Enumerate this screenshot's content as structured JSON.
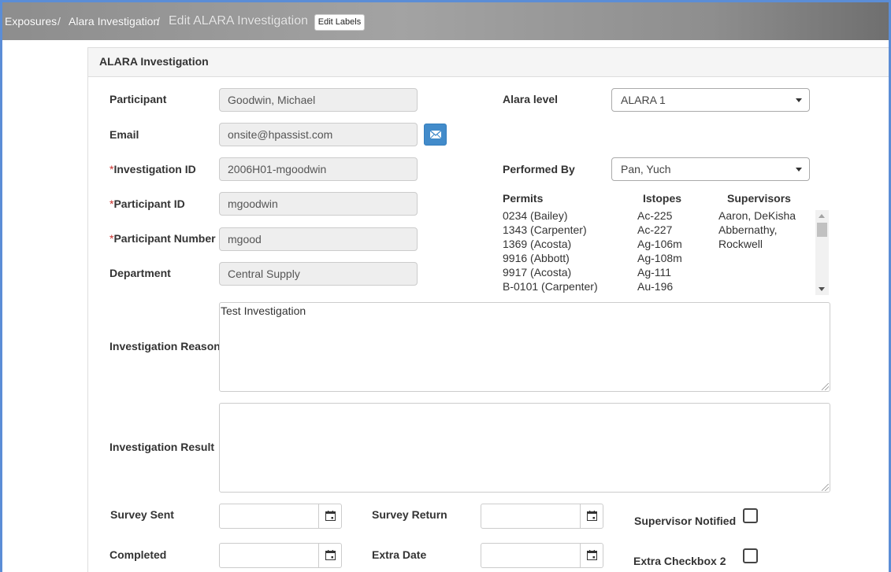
{
  "breadcrumb": {
    "items": [
      "Exposures",
      "Alara Investigation"
    ],
    "separator": "/",
    "current": "Edit ALARA Investigation",
    "edit_labels_button": "Edit Labels"
  },
  "panel": {
    "title": "ALARA Investigation"
  },
  "form": {
    "required_marker": "*",
    "participant": {
      "label": "Participant",
      "value": "Goodwin, Michael"
    },
    "email": {
      "label": "Email",
      "value": "onsite@hpassist.com",
      "button_icon": "envelope-icon"
    },
    "investigation_id": {
      "label": "Investigation ID",
      "value": "2006H01-mgoodwin"
    },
    "participant_id": {
      "label": "Participant ID",
      "value": "mgoodwin"
    },
    "participant_number": {
      "label": "Participant Number",
      "value": "mgood"
    },
    "department": {
      "label": "Department",
      "value": "Central Supply"
    },
    "alara_level": {
      "label": "Alara level",
      "value": "ALARA 1"
    },
    "performed_by": {
      "label": "Performed By",
      "value": "Pan, Yuch"
    },
    "lists": {
      "headers": {
        "permits": "Permits",
        "istopes": "Istopes",
        "supervisors": "Supervisors"
      },
      "permits": [
        "0234 (Bailey)",
        "1343 (Carpenter)",
        "1369 (Acosta)",
        "9916 (Abbott)",
        "9917 (Acosta)",
        "B-0101 (Carpenter)"
      ],
      "istopes": [
        "Ac-225",
        "Ac-227",
        "Ag-106m",
        "Ag-108m",
        "Ag-111",
        "Au-196"
      ],
      "supervisors": [
        "Aaron, DeKisha",
        "Abbernathy,",
        "Rockwell"
      ]
    },
    "investigation_reason": {
      "label": "Investigation Reason",
      "value": "Test Investigation"
    },
    "investigation_result": {
      "label": "Investigation Result",
      "value": ""
    },
    "survey_sent": {
      "label": "Survey Sent",
      "value": ""
    },
    "survey_return": {
      "label": "Survey Return",
      "value": ""
    },
    "supervisor_notified": {
      "label": "Supervisor Notified",
      "checked": false
    },
    "completed": {
      "label": "Completed",
      "value": ""
    },
    "extra_date": {
      "label": "Extra Date",
      "value": ""
    },
    "extra_checkbox_2": {
      "label": "Extra Checkbox 2",
      "checked": false
    }
  },
  "colors": {
    "frame_border": "#5b8dd6",
    "header_bar": "#9a9a9a",
    "mail_button": "#428bca",
    "required": "#c9302c",
    "readonly_field": "#eeeeee"
  }
}
